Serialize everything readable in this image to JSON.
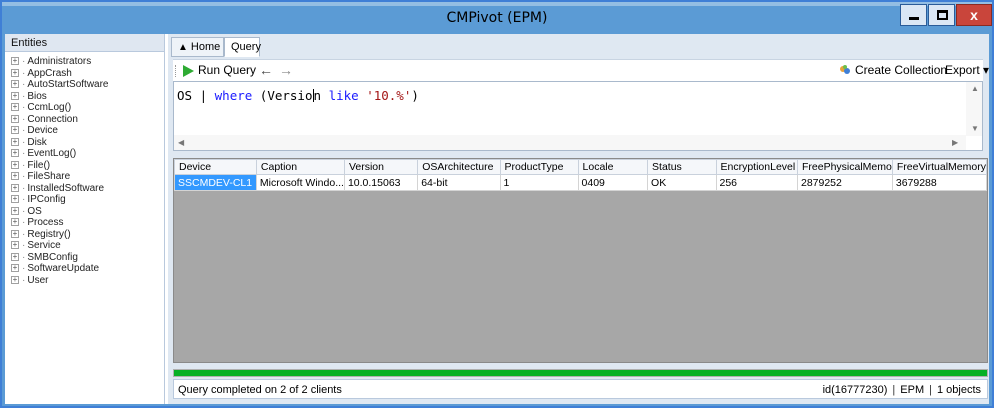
{
  "window": {
    "title": "CMPivot (EPM)",
    "close_glyph": "x"
  },
  "sidebar": {
    "header": "Entities",
    "items": [
      "Administrators",
      "AppCrash",
      "AutoStartSoftware",
      "Bios",
      "CcmLog()",
      "Connection",
      "Device",
      "Disk",
      "EventLog()",
      "File()",
      "FileShare",
      "InstalledSoftware",
      "IPConfig",
      "OS",
      "Process",
      "Registry()",
      "Service",
      "SMBConfig",
      "SoftwareUpdate",
      "User"
    ]
  },
  "tabs": {
    "home": "Home",
    "query": "Query"
  },
  "toolbar": {
    "run_query": "Run Query",
    "back_icon": "left-arrow-icon",
    "forward_icon": "right-arrow-icon",
    "create_collection": "Create Collection",
    "export": "Export ▾"
  },
  "editor": {
    "p1": "OS | ",
    "kw1": "where",
    "p2": " (Versio",
    "p3": "n ",
    "kw2": "like",
    "p4": " ",
    "str": "'10.%'",
    "p5": ")"
  },
  "grid": {
    "columns": [
      "Device",
      "Caption",
      "Version",
      "OSArchitecture",
      "ProductType",
      "Locale",
      "Status",
      "EncryptionLevel",
      "FreePhysicalMemo",
      "FreeVirtualMemory"
    ],
    "rows": [
      [
        "SSCMDEV-CL1",
        "Microsoft Windo...",
        "10.0.15063",
        "64-bit",
        "1",
        "0409",
        "OK",
        "256",
        "2879252",
        "3679288"
      ]
    ]
  },
  "progress": {
    "value": 1.0
  },
  "status": {
    "message": "Query completed on 2 of 2 clients",
    "id": "id(16777230)",
    "site": "EPM",
    "objects": "1 objects"
  },
  "colors": {
    "accent": "#5b9bd5",
    "selection": "#3399ff",
    "progress": "#06b025",
    "close": "#c9453b"
  }
}
